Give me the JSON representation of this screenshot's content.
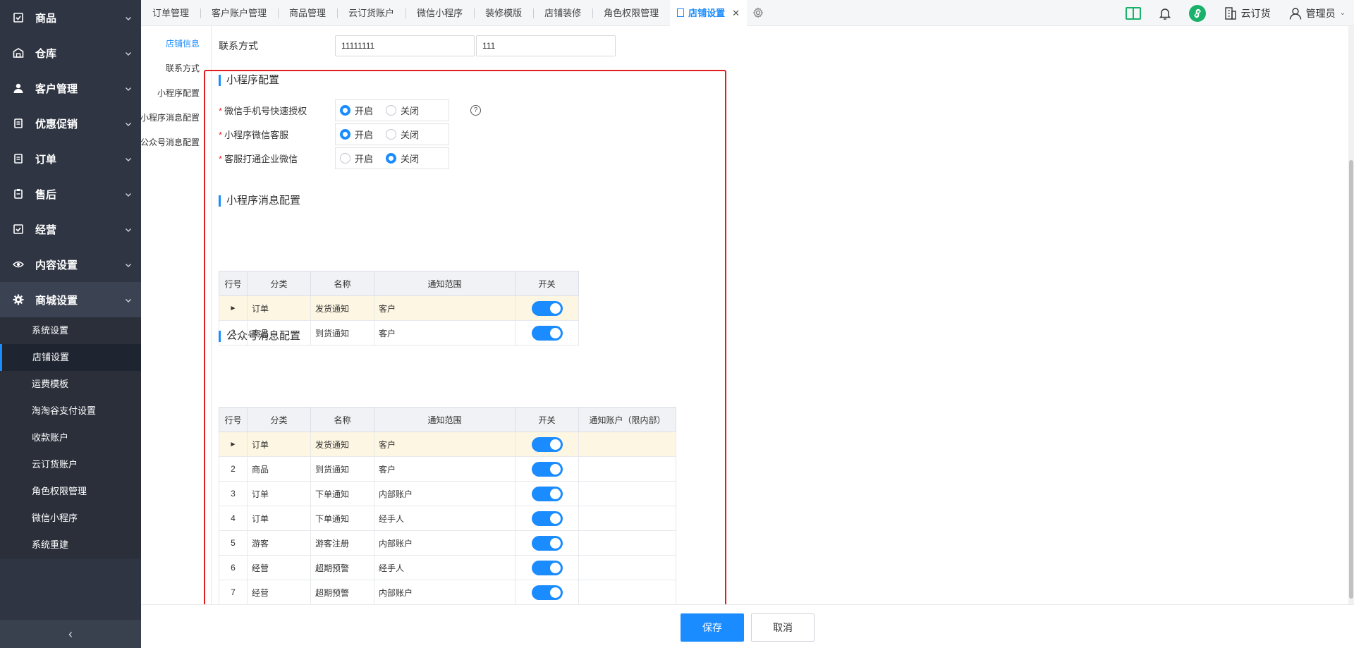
{
  "sidebar": {
    "menu": [
      {
        "label": "商品",
        "icon": "product-icon"
      },
      {
        "label": "仓库",
        "icon": "warehouse-icon"
      },
      {
        "label": "客户管理",
        "icon": "user-icon"
      },
      {
        "label": "优惠促销",
        "icon": "promotion-icon"
      },
      {
        "label": "订单",
        "icon": "order-icon"
      },
      {
        "label": "售后",
        "icon": "after-sale-icon"
      },
      {
        "label": "经营",
        "icon": "business-icon"
      },
      {
        "label": "内容设置",
        "icon": "eye-icon"
      },
      {
        "label": "商城设置",
        "icon": "gear-icon"
      }
    ],
    "submenu": [
      "系统设置",
      "店铺设置",
      "运费模板",
      "淘淘谷支付设置",
      "收款账户",
      "云订货账户",
      "角色权限管理",
      "微信小程序",
      "系统重建"
    ],
    "active_submenu": "店铺设置",
    "collapse_glyph": "‹"
  },
  "tabs": [
    "订单管理",
    "客户账户管理",
    "商品管理",
    "云订货账户",
    "微信小程序",
    "装修模版",
    "店铺装修",
    "角色权限管理",
    "店铺设置"
  ],
  "active_tab": "店铺设置",
  "topbar": {
    "store_label": "云订货",
    "user_label": "管理员"
  },
  "anchors": [
    "店铺信息",
    "联系方式",
    "小程序配置",
    "小程序消息配置",
    "公众号消息配置"
  ],
  "active_anchor": "店铺信息",
  "contact": {
    "label": "联系方式",
    "phone_value": "11111111",
    "second_value": "111"
  },
  "mini_program_config": {
    "title": "小程序配置",
    "options_on": "开启",
    "options_off": "关闭",
    "rows": [
      {
        "label": "微信手机号快速授权",
        "value": "开启",
        "help": "?"
      },
      {
        "label": "小程序微信客服",
        "value": "开启"
      },
      {
        "label": "客服打通企业微信",
        "value": "关闭"
      }
    ]
  },
  "mini_msg_config": {
    "title": "小程序消息配置",
    "headers": [
      "行号",
      "分类",
      "名称",
      "通知范围",
      "开关"
    ],
    "rows": [
      {
        "no": "►",
        "category": "订单",
        "name": "发货通知",
        "scope": "客户",
        "enabled": true,
        "current": true
      },
      {
        "no": "2",
        "category": "商品",
        "name": "到货通知",
        "scope": "客户",
        "enabled": true,
        "current": false
      }
    ]
  },
  "oa_msg_config": {
    "title": "公众号消息配置",
    "headers": [
      "行号",
      "分类",
      "名称",
      "通知范围",
      "开关",
      "通知账户（限内部）"
    ],
    "rows": [
      {
        "no": "►",
        "category": "订单",
        "name": "发货通知",
        "scope": "客户",
        "enabled": true,
        "account": "",
        "current": true
      },
      {
        "no": "2",
        "category": "商品",
        "name": "到货通知",
        "scope": "客户",
        "enabled": true,
        "account": "",
        "current": false
      },
      {
        "no": "3",
        "category": "订单",
        "name": "下单通知",
        "scope": "内部账户",
        "enabled": true,
        "account": "",
        "current": false
      },
      {
        "no": "4",
        "category": "订单",
        "name": "下单通知",
        "scope": "经手人",
        "enabled": true,
        "account": "",
        "current": false
      },
      {
        "no": "5",
        "category": "游客",
        "name": "游客注册",
        "scope": "内部账户",
        "enabled": true,
        "account": "",
        "current": false
      },
      {
        "no": "6",
        "category": "经营",
        "name": "超期预警",
        "scope": "经手人",
        "enabled": true,
        "account": "",
        "current": false
      },
      {
        "no": "7",
        "category": "经营",
        "name": "超期预警",
        "scope": "内部账户",
        "enabled": true,
        "account": "",
        "current": false
      }
    ]
  },
  "footer": {
    "save_label": "保存",
    "cancel_label": "取消"
  },
  "colors": {
    "accent": "#1a8cff",
    "sidebar_bg": "#2f3542",
    "highlight_border": "#e02020"
  }
}
